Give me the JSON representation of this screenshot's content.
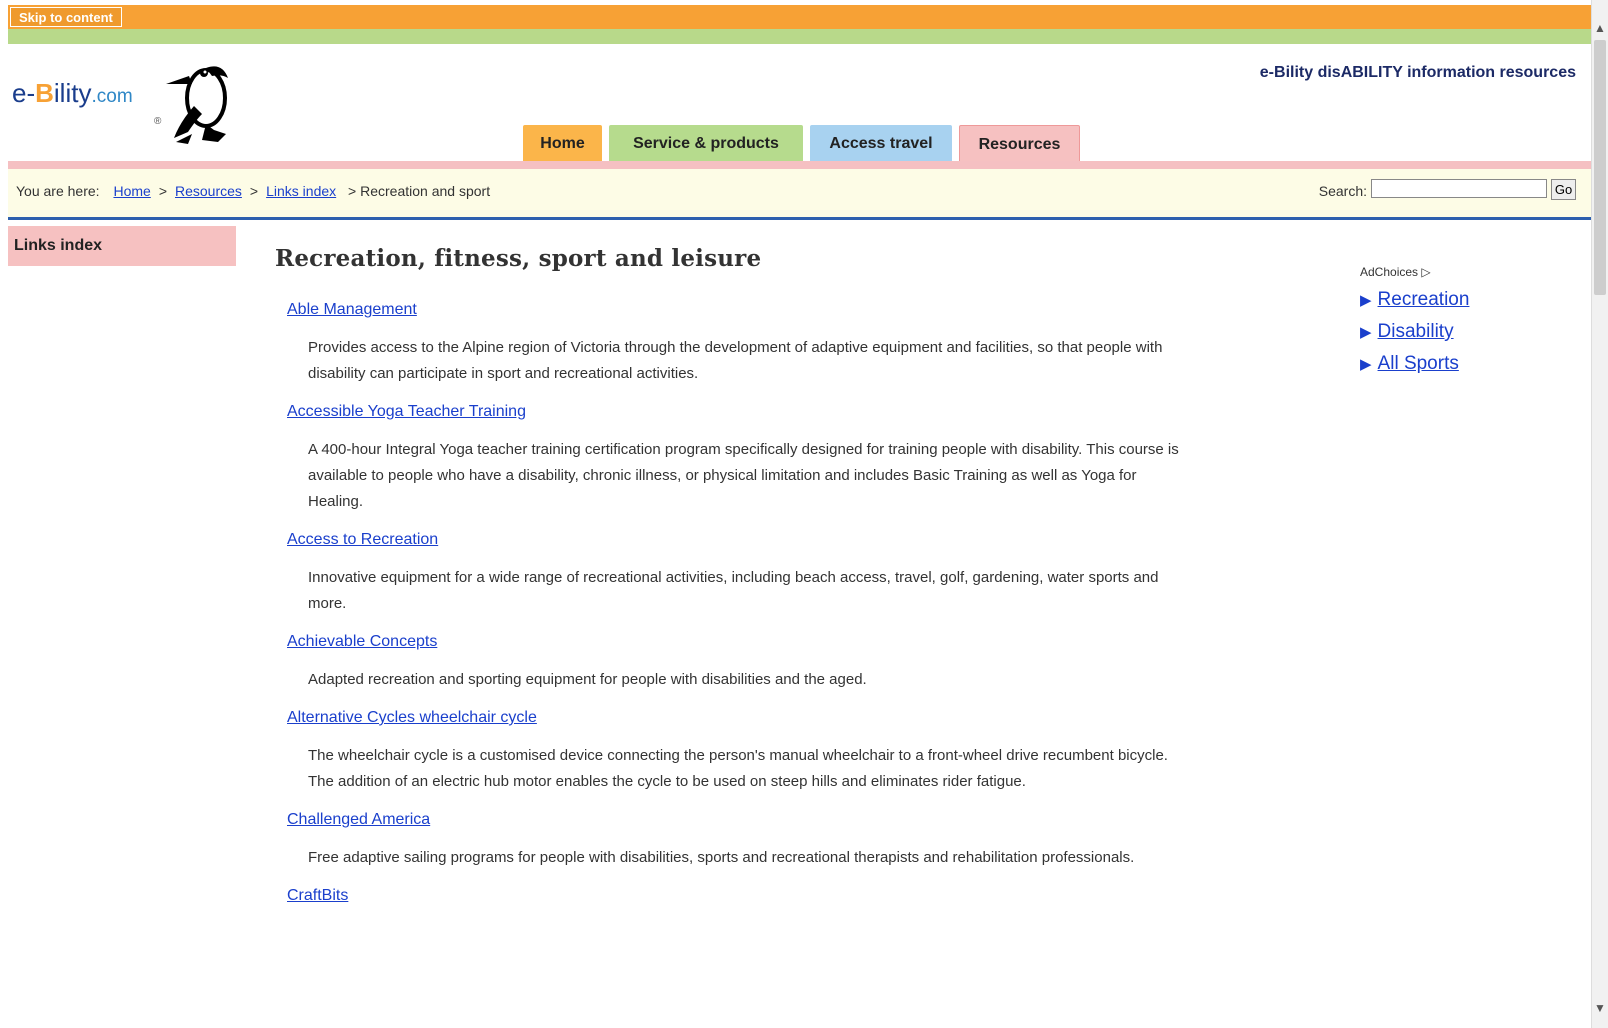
{
  "skip_link": "Skip to content",
  "logo": {
    "prefix": "e-",
    "b": "B",
    "rest": "ility",
    "dot_com": ".com",
    "reg": "®"
  },
  "tagline": "e-Bility disABILITY information resources",
  "tabs": [
    {
      "label": "Home"
    },
    {
      "label": "Service & products"
    },
    {
      "label": "Access travel"
    },
    {
      "label": "Resources"
    }
  ],
  "breadcrumb": {
    "prefix": "You are here:",
    "items": [
      "Home",
      "Resources",
      "Links index"
    ],
    "current": "> Recreation and sport",
    "separator": ">"
  },
  "search": {
    "label": "Search:",
    "value": "",
    "button": "Go"
  },
  "sidebar": {
    "title": "Links index"
  },
  "main": {
    "title": "Recreation, fitness, sport and leisure",
    "entries": [
      {
        "name": "Able Management",
        "desc": "Provides access to the Alpine region of Victoria through the development of adaptive equipment and facilities, so that people with disability can participate in sport and recreational activities."
      },
      {
        "name": "Accessible Yoga Teacher Training",
        "desc": "A 400-hour Integral Yoga teacher training certification program specifically designed for training people with disability. This course is available to people who have a disability, chronic illness, or physical limitation and includes Basic Training as well as Yoga for Healing."
      },
      {
        "name": "Access to Recreation",
        "desc": "Innovative equipment for a wide range of recreational activities, including beach access, travel, golf, gardening, water sports and more."
      },
      {
        "name": "Achievable Concepts",
        "desc": "Adapted recreation and sporting equipment for people with disabilities and the aged."
      },
      {
        "name": "Alternative Cycles wheelchair cycle",
        "desc": "The wheelchair cycle is a customised device connecting the person's manual wheelchair to a front-wheel drive recumbent bicycle. The addition of an electric hub motor enables the cycle to be used on steep hills and eliminates rider fatigue."
      },
      {
        "name": "Challenged America",
        "desc": "Free adaptive sailing programs for people with disabilities, sports and recreational therapists and rehabilitation professionals."
      },
      {
        "name": "CraftBits",
        "desc": ""
      }
    ]
  },
  "ads": {
    "adchoices": "AdChoices",
    "links": [
      {
        "label": "Recreation"
      },
      {
        "label": "Disability"
      },
      {
        "label": "All Sports"
      }
    ]
  },
  "colors": {
    "orange": "#f7a135",
    "green": "#b8d98a",
    "pink": "#f5c0c2",
    "link": "#1a3fcc",
    "navy": "#1c2a66"
  }
}
